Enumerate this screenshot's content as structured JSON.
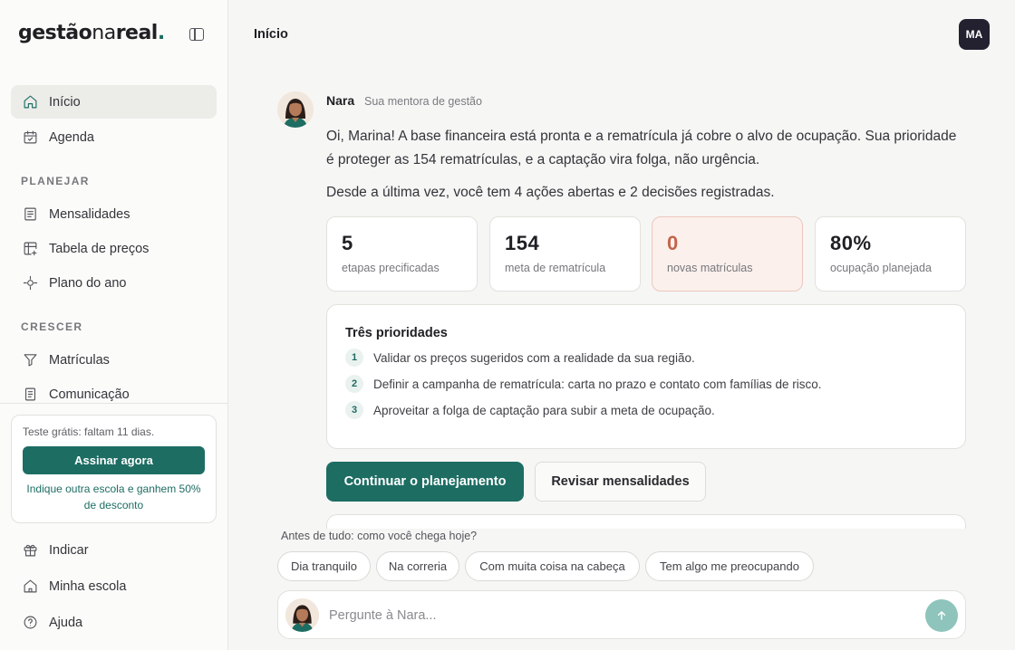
{
  "brand": {
    "part1": "gestão",
    "part2": "na",
    "part3": "real",
    "dot": "."
  },
  "sidebar": {
    "top_items": [
      {
        "label": "Início",
        "icon": "home-icon"
      },
      {
        "label": "Agenda",
        "icon": "calendar-icon"
      }
    ],
    "sections": [
      {
        "title": "PLANEJAR",
        "items": [
          {
            "label": "Mensalidades",
            "icon": "receipt-icon"
          },
          {
            "label": "Tabela de preços",
            "icon": "table-edit-icon"
          },
          {
            "label": "Plano do ano",
            "icon": "target-icon"
          }
        ]
      },
      {
        "title": "CRESCER",
        "items": [
          {
            "label": "Matrículas",
            "icon": "filter-icon"
          },
          {
            "label": "Comunicação",
            "icon": "document-icon"
          }
        ]
      }
    ],
    "trial": {
      "text": "Teste grátis: faltam 11 dias.",
      "cta": "Assinar agora",
      "referral": "Indique outra escola e ganhem 50% de desconto"
    },
    "bottom_items": [
      {
        "label": "Indicar",
        "icon": "gift-icon"
      },
      {
        "label": "Minha escola",
        "icon": "school-icon"
      },
      {
        "label": "Ajuda",
        "icon": "help-icon"
      }
    ]
  },
  "header": {
    "title": "Início",
    "user_initials": "MA"
  },
  "mentor": {
    "name": "Nara",
    "role": "Sua mentora de gestão",
    "message1": "Oi, Marina! A base financeira está pronta e a rematrícula já cobre o alvo de ocupação. Sua prioridade é proteger as 154 rematrículas, e a captação vira folga, não urgência.",
    "message2": "Desde a última vez, você tem 4 ações abertas e 2 decisões registradas."
  },
  "stats": [
    {
      "value": "5",
      "label": "etapas precificadas"
    },
    {
      "value": "154",
      "label": "meta de rematrícula"
    },
    {
      "value": "0",
      "label": "novas matrículas"
    },
    {
      "value": "80%",
      "label": "ocupação planejada"
    }
  ],
  "priorities": {
    "title": "Três prioridades",
    "items": [
      {
        "num": "1",
        "text": "Validar os preços sugeridos com a realidade da sua região."
      },
      {
        "num": "2",
        "text": "Definir a campanha de rematrícula: carta no prazo e contato com famílias de risco."
      },
      {
        "num": "3",
        "text": "Aproveitar a folga de captação para subir a meta de ocupação."
      }
    ]
  },
  "actions": {
    "primary": "Continuar o planejamento",
    "secondary": "Revisar mensalidades"
  },
  "mood": {
    "question": "Antes de tudo: como você chega hoje?",
    "options": [
      "Dia tranquilo",
      "Na correria",
      "Com muita coisa na cabeça",
      "Tem algo me preocupando"
    ]
  },
  "ask": {
    "placeholder": "Pergunte à Nara...",
    "send_icon": "arrow-up-icon"
  },
  "colors": {
    "accent": "#1d6d63",
    "warning": "#c2654c",
    "avatar_bg": "#23202f"
  }
}
